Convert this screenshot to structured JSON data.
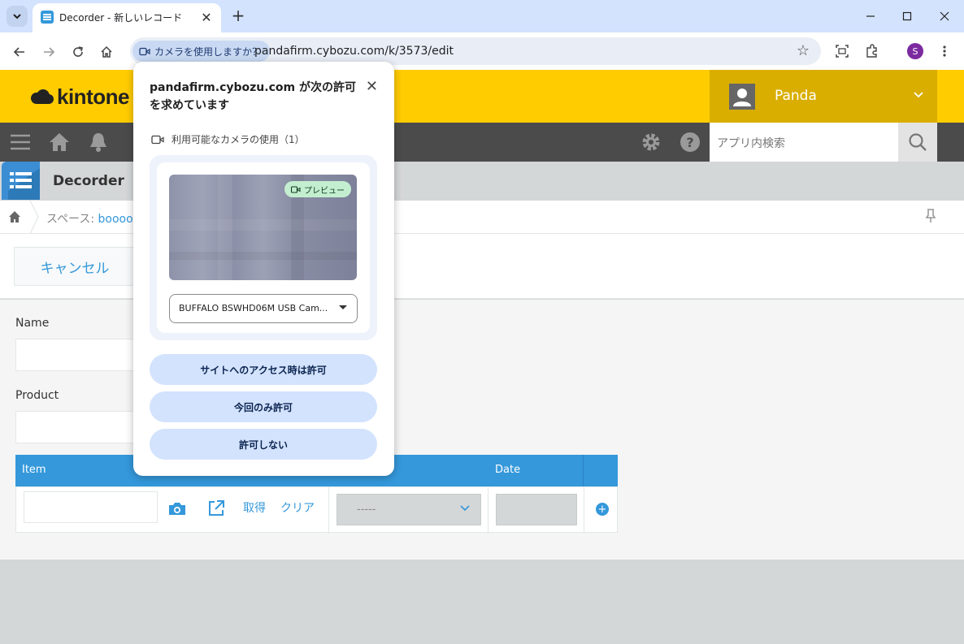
{
  "browser": {
    "tab": {
      "title": "Decorder - 新しいレコード"
    },
    "omnibox": {
      "camera_chip": "カメラを使用しますか？",
      "url": "pandafirm.cybozu.com/k/3573/edit"
    },
    "profile_initial": "S"
  },
  "kintone": {
    "logo_text": "kintone",
    "user_name": "Panda",
    "search_placeholder": "アプリ内検索",
    "app_title": "Decorder",
    "breadcrumb": {
      "prefix": "スペース: ",
      "space": "booooo"
    },
    "cancel_label": "キャンセル",
    "fields": {
      "name_label": "Name",
      "product_label": "Product"
    },
    "table": {
      "headers": {
        "item": "Item",
        "date": "Date"
      },
      "row": {
        "get_label": "取得",
        "clear_label": "クリア",
        "select_value": "-----"
      }
    }
  },
  "popup": {
    "title": "pandafirm.cybozu.com が次の許可を求めています",
    "permission_text": "利用可能なカメラの使用（1）",
    "preview_badge": "プレビュー",
    "camera_device": "BUFFALO BSWHD06M USB Cam...",
    "buttons": {
      "allow_always": "サイトへのアクセス時は許可",
      "allow_once": "今回のみ許可",
      "deny": "許可しない"
    }
  },
  "colors": {
    "kintone_yellow": "#ffcc00",
    "kintone_blue": "#3498db",
    "chrome_tab_bar": "#d3e3fd"
  }
}
